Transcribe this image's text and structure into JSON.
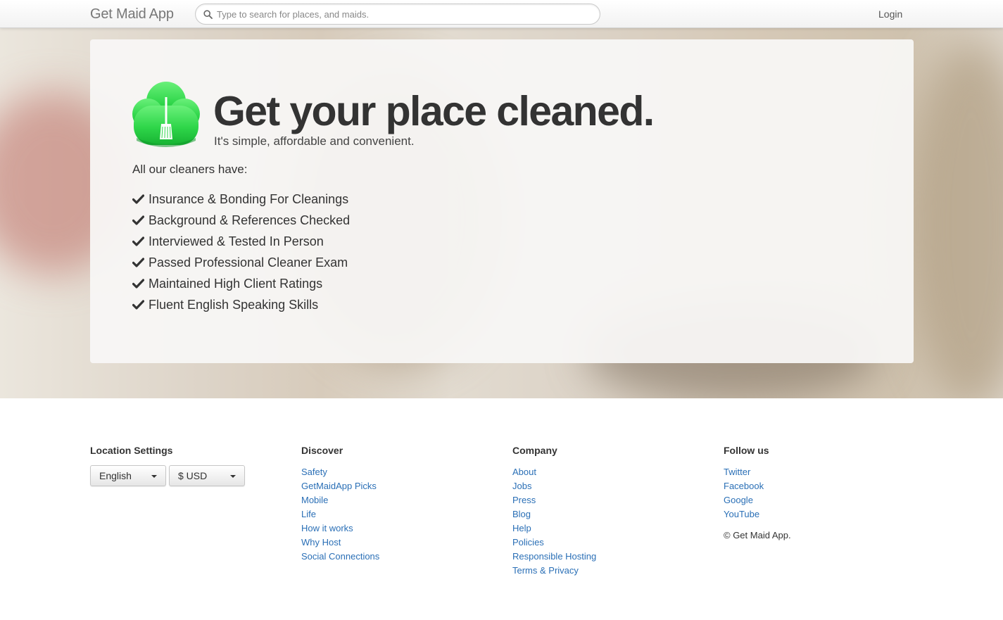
{
  "header": {
    "brand": "Get Maid App",
    "search_placeholder": "Type to search for places, and maids.",
    "login_label": "Login"
  },
  "hero": {
    "headline": "Get your place cleaned.",
    "tagline": "It's simple, affordable and convenient.",
    "intro": "All our cleaners have:",
    "features": [
      "Insurance & Bonding For Cleanings",
      "Background & References Checked",
      "Interviewed & Tested In Person",
      "Passed Professional Cleaner Exam",
      "Maintained High Client Ratings",
      "Fluent English Speaking Skills"
    ],
    "logo_icon": "green-cloud-broom-icon",
    "accent_color": "#2ecc40"
  },
  "footer": {
    "location": {
      "heading": "Location Settings",
      "language": "English",
      "currency": "$ USD"
    },
    "discover": {
      "heading": "Discover",
      "links": [
        "Safety",
        "GetMaidApp Picks",
        "Mobile",
        "Life",
        "How it works",
        "Why Host",
        "Social Connections"
      ]
    },
    "company": {
      "heading": "Company",
      "links": [
        "About",
        "Jobs",
        "Press",
        "Blog",
        "Help",
        "Policies",
        "Responsible Hosting",
        "Terms & Privacy"
      ]
    },
    "follow": {
      "heading": "Follow us",
      "links": [
        "Twitter",
        "Facebook",
        "Google",
        "YouTube"
      ],
      "copyright": "© Get Maid App."
    },
    "link_color": "#2a6fb6"
  }
}
